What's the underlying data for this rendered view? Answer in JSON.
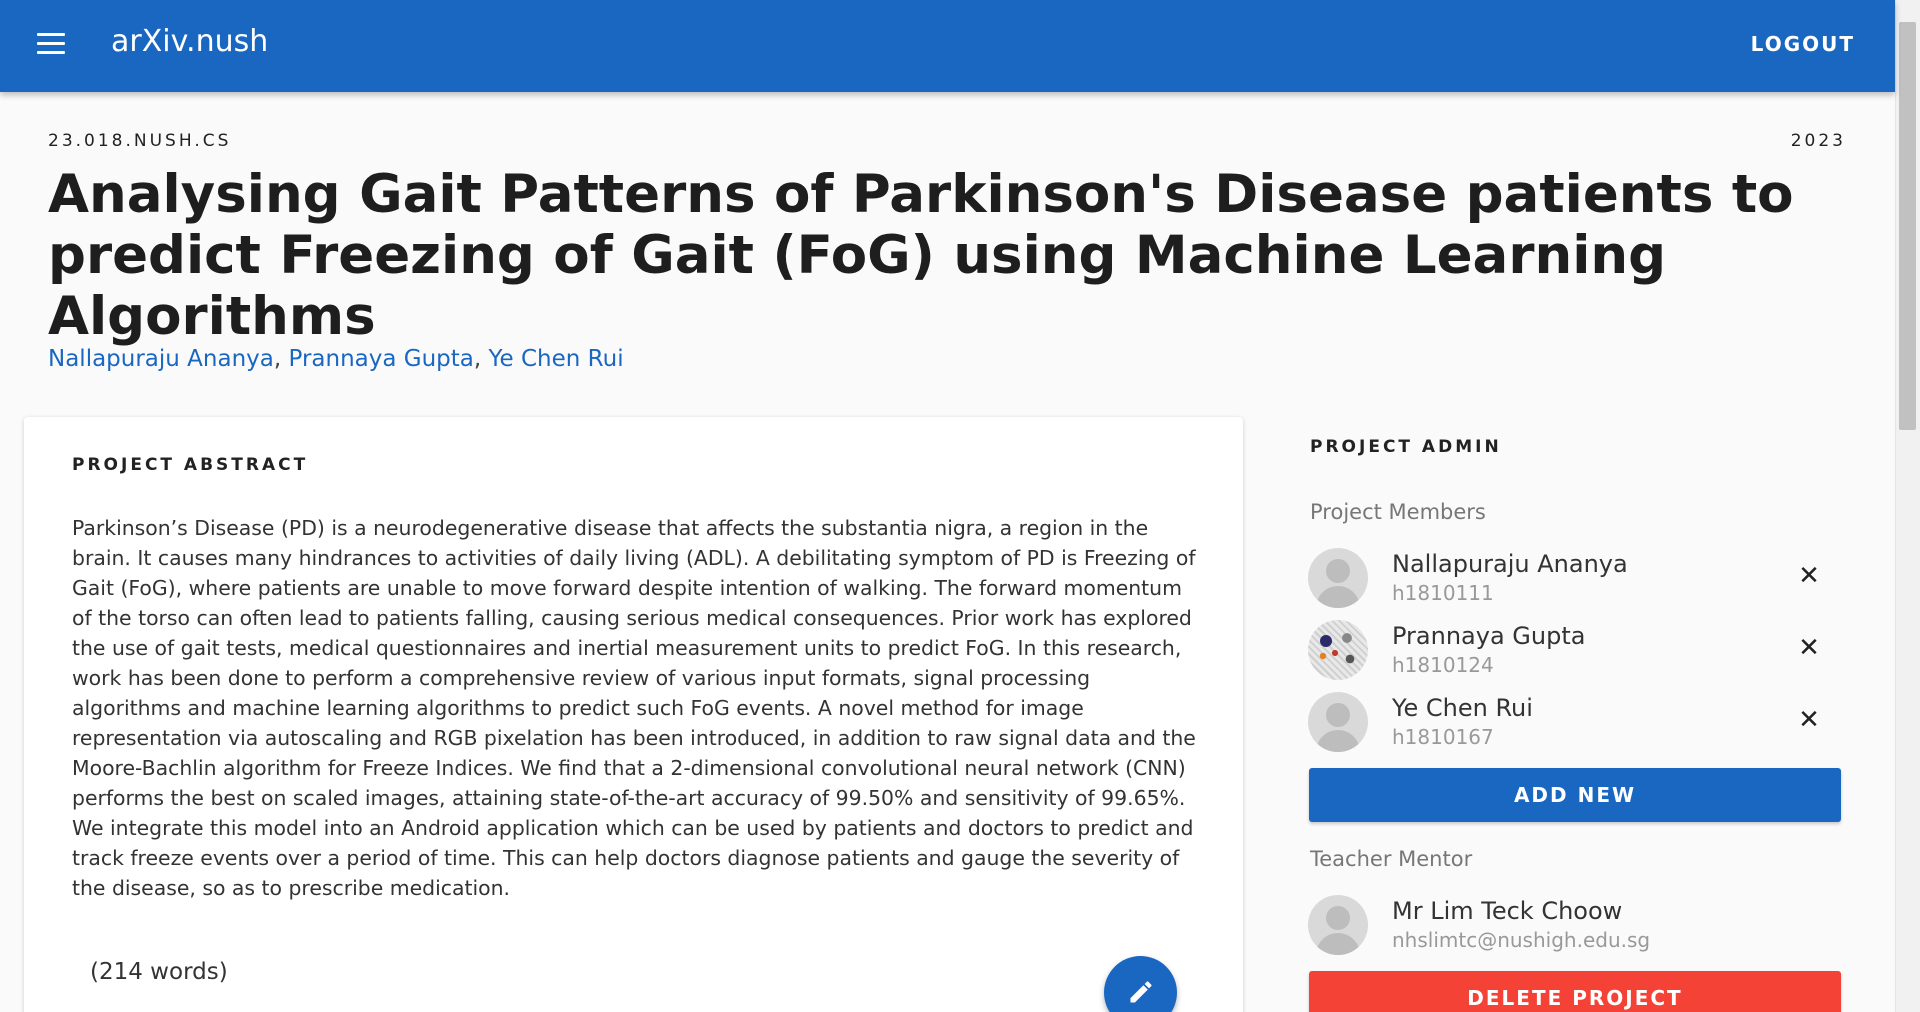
{
  "appbar": {
    "title": "arXiv.nush",
    "logout_label": "LOGOUT",
    "color": "#1a67c2"
  },
  "paper": {
    "id": "23.018.NUSH.CS",
    "year": "2023",
    "title": "Analysing Gait Patterns of Parkinson's Disease patients to predict Freezing of Gait (FoG) using Machine Learning Algorithms",
    "authors": [
      "Nallapuraju Ananya",
      "Prannaya Gupta",
      "Ye Chen Rui"
    ],
    "author_separator": ", "
  },
  "abstract": {
    "heading": "PROJECT ABSTRACT",
    "text": "Parkinson’s Disease (PD) is a neurodegenerative disease that affects the substantia nigra, a region in the brain. It causes many hindrances to activities of daily living (ADL). A debilitating symptom of PD is Freezing of Gait (FoG), where patients are unable to move forward despite intention of walking. The forward momentum of the torso can often lead to patients falling, causing serious medical consequences. Prior work has explored the use of gait tests, medical questionnaires and inertial measurement units to predict FoG. In this research, work has been done to perform a comprehensive review of various input formats, signal processing algorithms and machine learning algorithms to predict such FoG events. A novel method for image representation via autoscaling and RGB pixelation has been introduced, in addition to raw signal data and the Moore-Bachlin algorithm for Freeze Indices. We find that a 2-dimensional convolutional neural network (CNN) performs the best on scaled images, attaining state-of-the-art accuracy of 99.50% and sensitivity of 99.65%. We integrate this model into an Android application which can be used by patients and doctors to predict and track freeze events over a period of time. This can help doctors diagnose patients and gauge the severity of the disease, so as to prescribe medication.",
    "word_count": "(214 words)",
    "edit_icon": "pencil-icon"
  },
  "admin": {
    "heading": "PROJECT ADMIN",
    "members_label": "Project Members",
    "members": [
      {
        "name": "Nallapuraju Ananya",
        "id": "h1810111",
        "avatar": "default"
      },
      {
        "name": "Prannaya Gupta",
        "id": "h1810124",
        "avatar": "photo"
      },
      {
        "name": "Ye Chen Rui",
        "id": "h1810167",
        "avatar": "default"
      }
    ],
    "remove_glyph": "✕",
    "add_new_label": "ADD NEW",
    "mentor_label": "Teacher Mentor",
    "mentor": {
      "name": "Mr Lim Teck Choow",
      "email": "nhslimtc@nushigh.edu.sg"
    },
    "delete_label": "DELETE PROJECT",
    "delete_color": "#f44336"
  }
}
